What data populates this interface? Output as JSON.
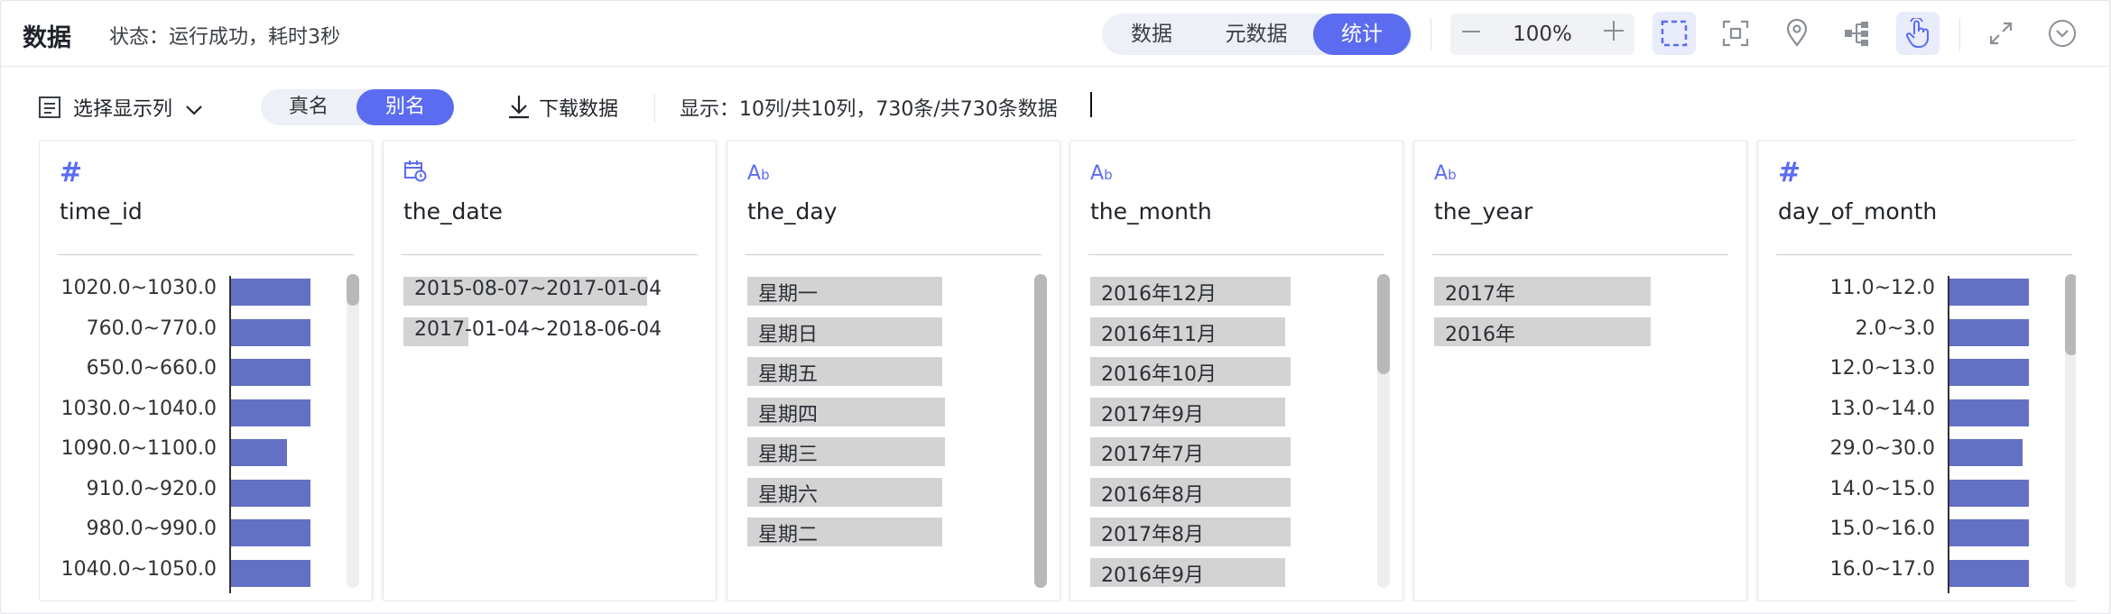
{
  "header": {
    "title": "数据",
    "status": "状态：运行成功，耗时3秒",
    "tabs": [
      {
        "label": "数据",
        "active": false
      },
      {
        "label": "元数据",
        "active": false
      },
      {
        "label": "统计",
        "active": true
      }
    ],
    "zoom": {
      "value": "100%",
      "minus": "—",
      "plus": "+"
    },
    "tools": [
      "select-area-icon",
      "fit-screen-icon",
      "location-pin-icon",
      "tree-structure-icon",
      "hand-pointer-icon",
      "fullscreen-icon",
      "collapse-chevron-icon"
    ],
    "accent": "#5b6cf0"
  },
  "toolbar": {
    "select_columns": "选择显示列",
    "name_toggle": [
      {
        "label": "真名",
        "active": false
      },
      {
        "label": "别名",
        "active": true
      }
    ],
    "download": "下载数据",
    "info": "显示：10列/共10列，730条/共730条数据"
  },
  "columns": [
    {
      "type": "numeric",
      "type_icon": "#",
      "name": "time_id",
      "bars": [
        {
          "label": "1020.0~1030.0",
          "value": 1.0
        },
        {
          "label": "760.0~770.0",
          "value": 1.0
        },
        {
          "label": "650.0~660.0",
          "value": 1.0
        },
        {
          "label": "1030.0~1040.0",
          "value": 1.0
        },
        {
          "label": "1090.0~1100.0",
          "value": 0.7
        },
        {
          "label": "910.0~920.0",
          "value": 1.0
        },
        {
          "label": "980.0~990.0",
          "value": 1.0
        },
        {
          "label": "1040.0~1050.0",
          "value": 1.0
        }
      ],
      "scroll": {
        "thumb_start": 0.0,
        "thumb_size": 0.1
      }
    },
    {
      "type": "date",
      "type_icon": "calendar-clock-icon",
      "name": "the_date",
      "items": [
        {
          "label": "2015-08-07~2017-01-04",
          "value": 0.9
        },
        {
          "label": "2017-01-04~2018-06-04",
          "value": 0.24
        }
      ]
    },
    {
      "type": "text",
      "type_icon": "Ab",
      "name": "the_day",
      "items": [
        {
          "label": "星期一",
          "value": 0.72
        },
        {
          "label": "星期日",
          "value": 0.72
        },
        {
          "label": "星期五",
          "value": 0.72
        },
        {
          "label": "星期四",
          "value": 0.73
        },
        {
          "label": "星期三",
          "value": 0.73
        },
        {
          "label": "星期六",
          "value": 0.72
        },
        {
          "label": "星期二",
          "value": 0.72
        }
      ],
      "scroll": {
        "thumb_start": 0.0,
        "thumb_size": 1.0
      }
    },
    {
      "type": "text",
      "type_icon": "Ab",
      "name": "the_month",
      "items": [
        {
          "label": "2016年12月",
          "value": 0.74
        },
        {
          "label": "2016年11月",
          "value": 0.72
        },
        {
          "label": "2016年10月",
          "value": 0.74
        },
        {
          "label": "2017年9月",
          "value": 0.72
        },
        {
          "label": "2017年7月",
          "value": 0.74
        },
        {
          "label": "2016年8月",
          "value": 0.74
        },
        {
          "label": "2017年8月",
          "value": 0.74
        },
        {
          "label": "2016年9月",
          "value": 0.72
        }
      ],
      "scroll": {
        "thumb_start": 0.0,
        "thumb_size": 0.32
      }
    },
    {
      "type": "text",
      "type_icon": "Ab",
      "name": "the_year",
      "items": [
        {
          "label": "2017年",
          "value": 0.8
        },
        {
          "label": "2016年",
          "value": 0.8
        }
      ]
    },
    {
      "type": "numeric",
      "type_icon": "#",
      "name": "day_of_month",
      "bars": [
        {
          "label": "11.0~12.0",
          "value": 1.0
        },
        {
          "label": "2.0~3.0",
          "value": 1.0
        },
        {
          "label": "12.0~13.0",
          "value": 1.0
        },
        {
          "label": "13.0~14.0",
          "value": 1.0
        },
        {
          "label": "29.0~30.0",
          "value": 0.92
        },
        {
          "label": "14.0~15.0",
          "value": 1.0
        },
        {
          "label": "15.0~16.0",
          "value": 1.0
        },
        {
          "label": "16.0~17.0",
          "value": 1.0
        }
      ],
      "scroll": {
        "thumb_start": 0.0,
        "thumb_size": 0.26
      }
    }
  ]
}
